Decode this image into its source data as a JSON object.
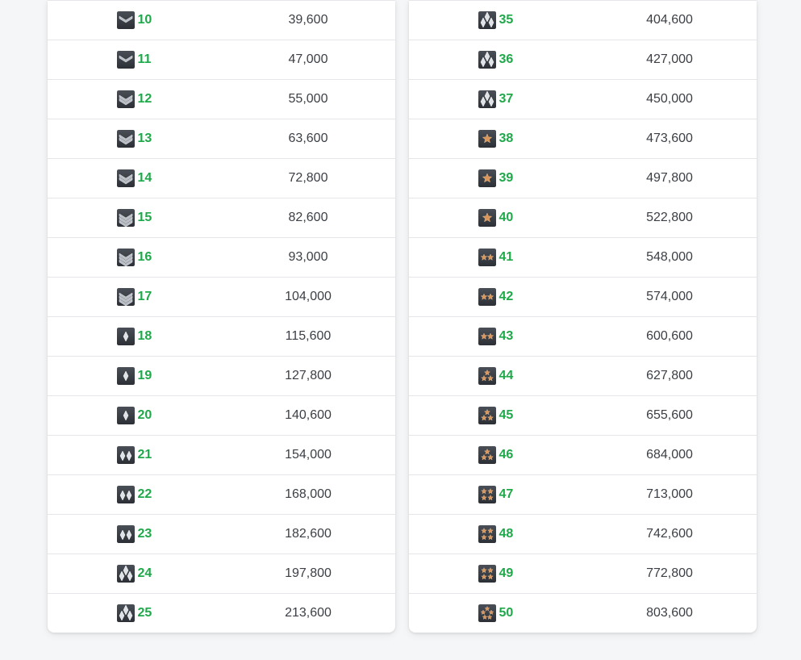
{
  "tables": [
    {
      "rows": [
        {
          "rank": "10",
          "xp": "39,600",
          "icon": "chevron-1-rank-icon"
        },
        {
          "rank": "11",
          "xp": "47,000",
          "icon": "chevron-1-rank-icon"
        },
        {
          "rank": "12",
          "xp": "55,000",
          "icon": "chevron-2-rank-icon"
        },
        {
          "rank": "13",
          "xp": "63,600",
          "icon": "chevron-2-rank-icon"
        },
        {
          "rank": "14",
          "xp": "72,800",
          "icon": "chevron-2-rank-icon"
        },
        {
          "rank": "15",
          "xp": "82,600",
          "icon": "chevron-3-rank-icon"
        },
        {
          "rank": "16",
          "xp": "93,000",
          "icon": "chevron-3-rank-icon"
        },
        {
          "rank": "17",
          "xp": "104,000",
          "icon": "chevron-3-rank-icon"
        },
        {
          "rank": "18",
          "xp": "115,600",
          "icon": "diamond-1-rank-icon"
        },
        {
          "rank": "19",
          "xp": "127,800",
          "icon": "diamond-1-rank-icon"
        },
        {
          "rank": "20",
          "xp": "140,600",
          "icon": "diamond-1-rank-icon"
        },
        {
          "rank": "21",
          "xp": "154,000",
          "icon": "diamond-2-rank-icon"
        },
        {
          "rank": "22",
          "xp": "168,000",
          "icon": "diamond-2-rank-icon"
        },
        {
          "rank": "23",
          "xp": "182,600",
          "icon": "diamond-2-rank-icon"
        },
        {
          "rank": "24",
          "xp": "197,800",
          "icon": "diamond-3-rank-icon"
        },
        {
          "rank": "25",
          "xp": "213,600",
          "icon": "diamond-3-rank-icon"
        }
      ]
    },
    {
      "rows": [
        {
          "rank": "35",
          "xp": "404,600",
          "icon": "diamond-3-rank-icon"
        },
        {
          "rank": "36",
          "xp": "427,000",
          "icon": "diamond-3-rank-icon"
        },
        {
          "rank": "37",
          "xp": "450,000",
          "icon": "diamond-3-rank-icon"
        },
        {
          "rank": "38",
          "xp": "473,600",
          "icon": "star-1-rank-icon"
        },
        {
          "rank": "39",
          "xp": "497,800",
          "icon": "star-1-rank-icon"
        },
        {
          "rank": "40",
          "xp": "522,800",
          "icon": "star-1-rank-icon"
        },
        {
          "rank": "41",
          "xp": "548,000",
          "icon": "star-2-rank-icon"
        },
        {
          "rank": "42",
          "xp": "574,000",
          "icon": "star-2-rank-icon"
        },
        {
          "rank": "43",
          "xp": "600,600",
          "icon": "star-2-rank-icon"
        },
        {
          "rank": "44",
          "xp": "627,800",
          "icon": "star-3-rank-icon"
        },
        {
          "rank": "45",
          "xp": "655,600",
          "icon": "star-3-rank-icon"
        },
        {
          "rank": "46",
          "xp": "684,000",
          "icon": "star-3-rank-icon"
        },
        {
          "rank": "47",
          "xp": "713,000",
          "icon": "star-4-rank-icon"
        },
        {
          "rank": "48",
          "xp": "742,600",
          "icon": "star-4-rank-icon"
        },
        {
          "rank": "49",
          "xp": "772,800",
          "icon": "star-4-rank-icon"
        },
        {
          "rank": "50",
          "xp": "803,600",
          "icon": "star-5-rank-icon"
        }
      ]
    }
  ],
  "colors": {
    "rank_number": "#1fa84a",
    "xp_text": "#3b3f45",
    "row_divider": "#e4e6ea",
    "page_background": "#f5f6f8",
    "card_background": "#ffffff"
  }
}
